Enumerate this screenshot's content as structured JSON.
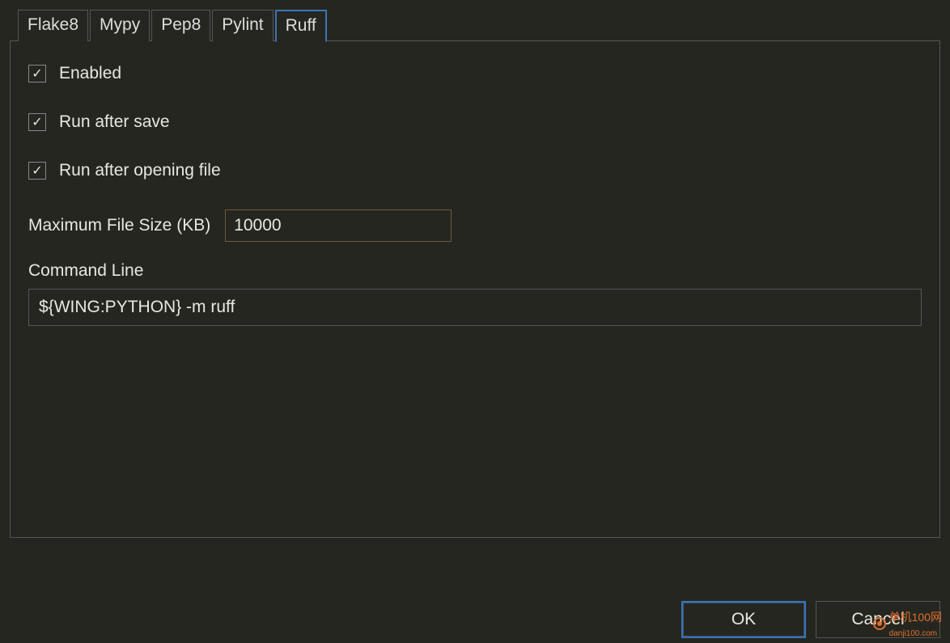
{
  "tabs": [
    {
      "label": "Flake8",
      "active": false
    },
    {
      "label": "Mypy",
      "active": false
    },
    {
      "label": "Pep8",
      "active": false
    },
    {
      "label": "Pylint",
      "active": false
    },
    {
      "label": "Ruff",
      "active": true
    }
  ],
  "panel": {
    "enabled": {
      "label": "Enabled",
      "checked": true
    },
    "run_after_save": {
      "label": "Run after save",
      "checked": true
    },
    "run_after_open": {
      "label": "Run after opening file",
      "checked": true
    },
    "max_file_size": {
      "label": "Maximum File Size (KB)",
      "value": "10000"
    },
    "command_line": {
      "label": "Command Line",
      "value": "${WING:PYTHON} -m ruff"
    }
  },
  "buttons": {
    "ok": "OK",
    "cancel": "Cancel"
  },
  "watermark": "单机100网\ndanji100.com"
}
